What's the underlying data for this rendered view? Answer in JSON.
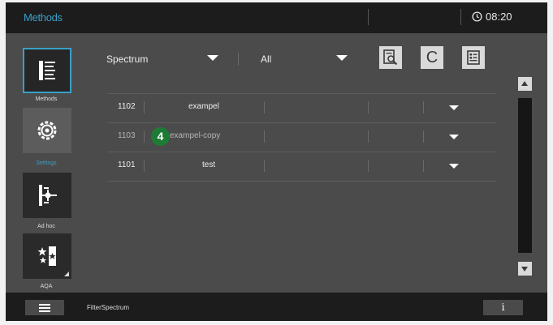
{
  "header": {
    "title": "Methods",
    "time": "08:20",
    "clock_icon": "clock-icon"
  },
  "sidebar": {
    "items": [
      {
        "label": "Methods",
        "icon": "methods-list-icon",
        "active": true
      },
      {
        "label": "Settings",
        "icon": "gear-icon",
        "active": false
      },
      {
        "label": "Ad hoc",
        "icon": "ad-hoc-icon",
        "active": false
      },
      {
        "label": "AQA",
        "icon": "aqa-icon",
        "active": false
      }
    ]
  },
  "filters": {
    "type_value": "Spectrum",
    "scope_value": "All"
  },
  "toolbar": {
    "icons": [
      "search-document-icon",
      "c-icon",
      "edit-list-icon"
    ],
    "c_label": "C"
  },
  "methods": [
    {
      "id": "1102",
      "name": "exampel"
    },
    {
      "id": "1103",
      "name": "exampel-copy"
    },
    {
      "id": "1101",
      "name": "test"
    }
  ],
  "callout": {
    "number": "4"
  },
  "footer": {
    "status": "FilterSpectrum",
    "info_label": "i"
  },
  "colors": {
    "accent": "#3a9fc8",
    "callout": "#1e7b36",
    "bar": "#1c1c1c",
    "panel": "#4b4b4b"
  }
}
